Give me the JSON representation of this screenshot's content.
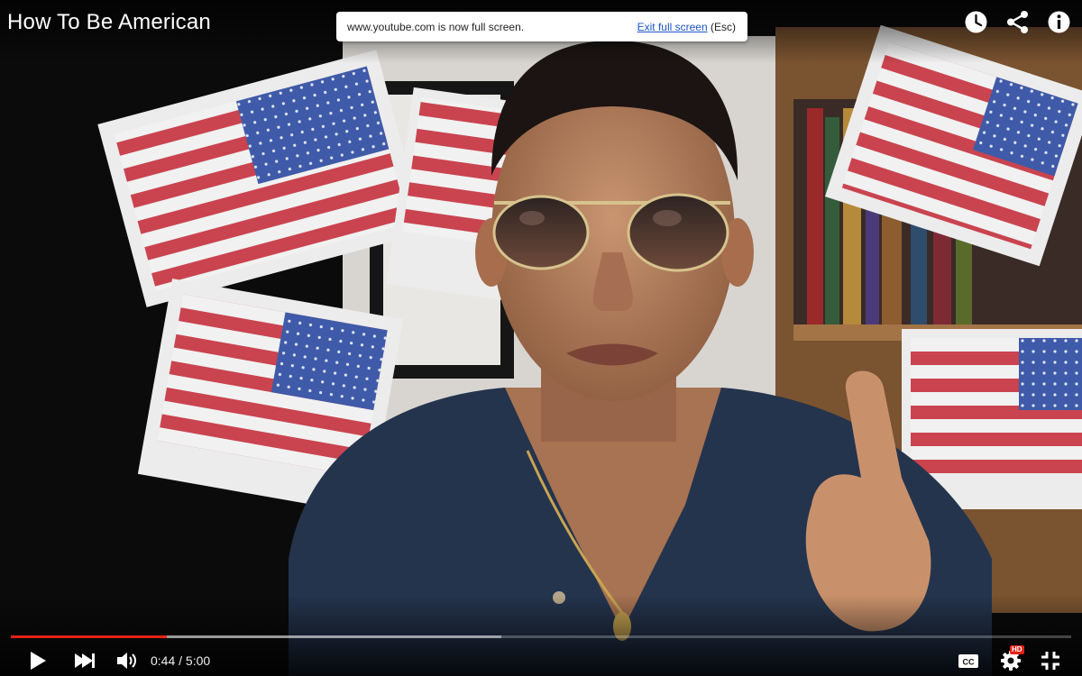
{
  "video": {
    "title": "How To Be American",
    "progress_fraction": 0.147,
    "buffered_fraction": 0.463
  },
  "fullscreen_notice": {
    "message": "www.youtube.com is now full screen.",
    "exit_link": "Exit full screen",
    "exit_hint": "(Esc)"
  },
  "controls": {
    "current_time": "0:44",
    "duration": "5:00",
    "time_separator": " / "
  },
  "quality_badge": "HD",
  "icons": {
    "watch_later": "clock-icon",
    "share": "share-icon",
    "info": "info-icon",
    "play": "play-icon",
    "next": "next-icon",
    "volume": "volume-icon",
    "captions": "captions-icon",
    "settings": "gear-icon",
    "fullscreen_exit": "exit-fullscreen-icon"
  },
  "colors": {
    "progress_played": "#e62117",
    "link": "#1a55c8"
  }
}
